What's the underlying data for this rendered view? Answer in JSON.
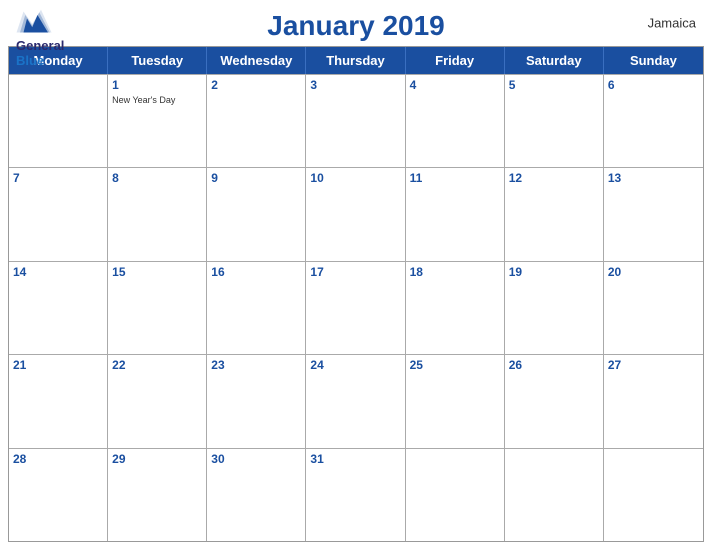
{
  "header": {
    "logo": {
      "general": "General",
      "blue": "Blue",
      "bird_shape": true
    },
    "title": "January 2019",
    "country": "Jamaica"
  },
  "day_headers": [
    "Monday",
    "Tuesday",
    "Wednesday",
    "Thursday",
    "Friday",
    "Saturday",
    "Sunday"
  ],
  "weeks": [
    [
      {
        "day": "",
        "empty": true
      },
      {
        "day": "1",
        "event": "New Year's Day"
      },
      {
        "day": "2",
        "event": ""
      },
      {
        "day": "3",
        "event": ""
      },
      {
        "day": "4",
        "event": ""
      },
      {
        "day": "5",
        "event": ""
      },
      {
        "day": "6",
        "event": ""
      }
    ],
    [
      {
        "day": "7",
        "event": ""
      },
      {
        "day": "8",
        "event": ""
      },
      {
        "day": "9",
        "event": ""
      },
      {
        "day": "10",
        "event": ""
      },
      {
        "day": "11",
        "event": ""
      },
      {
        "day": "12",
        "event": ""
      },
      {
        "day": "13",
        "event": ""
      }
    ],
    [
      {
        "day": "14",
        "event": ""
      },
      {
        "day": "15",
        "event": ""
      },
      {
        "day": "16",
        "event": ""
      },
      {
        "day": "17",
        "event": ""
      },
      {
        "day": "18",
        "event": ""
      },
      {
        "day": "19",
        "event": ""
      },
      {
        "day": "20",
        "event": ""
      }
    ],
    [
      {
        "day": "21",
        "event": ""
      },
      {
        "day": "22",
        "event": ""
      },
      {
        "day": "23",
        "event": ""
      },
      {
        "day": "24",
        "event": ""
      },
      {
        "day": "25",
        "event": ""
      },
      {
        "day": "26",
        "event": ""
      },
      {
        "day": "27",
        "event": ""
      }
    ],
    [
      {
        "day": "28",
        "event": ""
      },
      {
        "day": "29",
        "event": ""
      },
      {
        "day": "30",
        "event": ""
      },
      {
        "day": "31",
        "event": ""
      },
      {
        "day": "",
        "empty": true
      },
      {
        "day": "",
        "empty": true
      },
      {
        "day": "",
        "empty": true
      }
    ]
  ]
}
